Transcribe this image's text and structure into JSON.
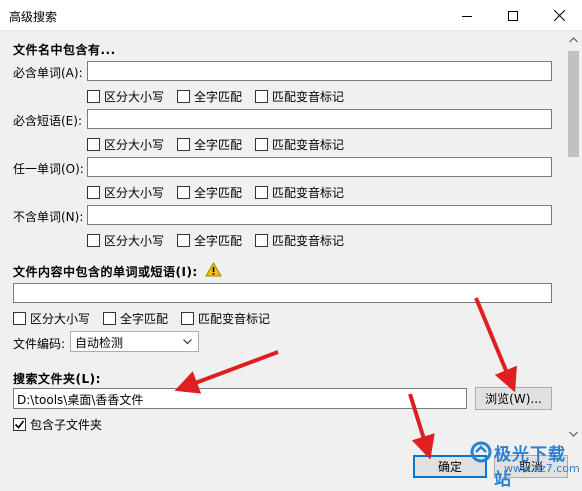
{
  "window": {
    "title": "高级搜索",
    "minimize_icon": "minimize-icon",
    "maximize_icon": "maximize-icon",
    "close_icon": "close-icon"
  },
  "filename_section": {
    "title": "文件名中包含有...",
    "fields": [
      {
        "label": "必含单词(A):",
        "value": ""
      },
      {
        "label": "必含短语(E):",
        "value": ""
      },
      {
        "label": "任一单词(O):",
        "value": ""
      },
      {
        "label": "不含单词(N):",
        "value": ""
      }
    ],
    "options": [
      "区分大小写",
      "全字匹配",
      "匹配变音标记"
    ]
  },
  "content_section": {
    "title": "文件内容中包含的单词或短语(I):",
    "warning_icon": "warning-icon",
    "value": "",
    "options": [
      "区分大小写",
      "全字匹配",
      "匹配变音标记"
    ],
    "encoding_label": "文件编码:",
    "encoding_value": "自动检测"
  },
  "folder_section": {
    "title": "搜索文件夹(L):",
    "path": "D:\\tools\\桌面\\香香文件",
    "browse_label": "浏览(W)...",
    "include_subfolders_label": "包含子文件夹",
    "include_subfolders_checked": true
  },
  "footer": {
    "ok_label": "确定",
    "cancel_label": "取消"
  },
  "watermark": {
    "text": "极光下载站",
    "url": "www.xz7.com"
  },
  "colors": {
    "accent": "#0078d7",
    "annotation_arrow": "#e02020",
    "warning": "#f0c020"
  }
}
